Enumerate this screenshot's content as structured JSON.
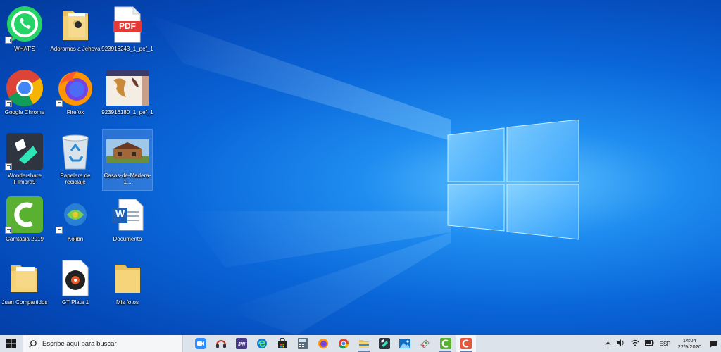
{
  "desktop": {
    "icons": [
      {
        "label": "WHAT'S",
        "type": "whatsapp"
      },
      {
        "label": "Adoramos a Jehová",
        "type": "folder-doc"
      },
      {
        "label": "923916243_1_pef_1",
        "type": "pdf"
      },
      {
        "label": "Google Chrome",
        "type": "chrome"
      },
      {
        "label": "Firefox",
        "type": "firefox"
      },
      {
        "label": "923916180_1_pef_1",
        "type": "photo-seahorse"
      },
      {
        "label": "Wondershare Filmora9",
        "type": "filmora"
      },
      {
        "label": "Papelera de reciclaje",
        "type": "recycle"
      },
      {
        "label": "Casas-de-Madera-1...",
        "type": "photo-house"
      },
      {
        "label": "Camtasia 2019",
        "type": "camtasia"
      },
      {
        "label": "Kolibri",
        "type": "kolibri"
      },
      {
        "label": "Documento",
        "type": "word"
      },
      {
        "label": "Juan Compartidos",
        "type": "folder-docs"
      },
      {
        "label": "GT Plata 1",
        "type": "vinyl"
      },
      {
        "label": "Mis fotos",
        "type": "folder"
      }
    ],
    "pdf_badge": "PDF",
    "word_badge": "W"
  },
  "taskbar": {
    "search_placeholder": "Escribe aquí para buscar",
    "pinned": [
      {
        "name": "zoom"
      },
      {
        "name": "headset"
      },
      {
        "name": "jw-app"
      },
      {
        "name": "edge"
      },
      {
        "name": "store"
      },
      {
        "name": "calculator"
      },
      {
        "name": "firefox"
      },
      {
        "name": "chrome"
      },
      {
        "name": "file-explorer"
      },
      {
        "name": "filmora"
      },
      {
        "name": "photos"
      },
      {
        "name": "paint"
      },
      {
        "name": "camtasia"
      },
      {
        "name": "camtasia-recorder"
      }
    ],
    "language": "ESP",
    "time": "14:04",
    "date": "22/9/2020"
  },
  "colors": {
    "taskbar_bg": "#dde3ea",
    "desktop_accent": "#0a66d8"
  }
}
